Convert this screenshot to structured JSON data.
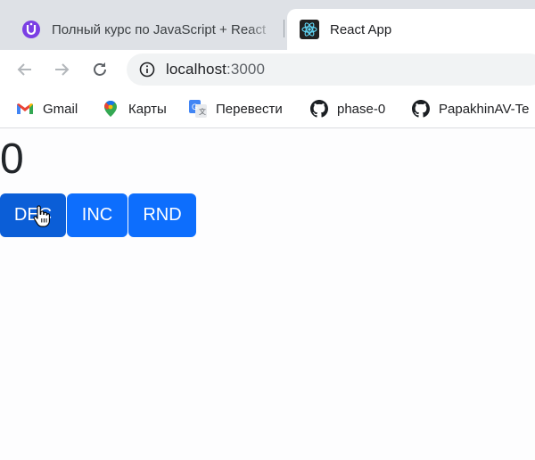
{
  "tabs": [
    {
      "title": "Полный курс по JavaScript + React",
      "favicon": "ulbi-logo-icon",
      "active": false
    },
    {
      "title": "React App",
      "favicon": "react-logo-icon",
      "active": true
    }
  ],
  "toolbar": {
    "url_host": "localhost",
    "url_port": ":3000"
  },
  "bookmarks": [
    {
      "label": "Gmail",
      "icon": "gmail-icon"
    },
    {
      "label": "Карты",
      "icon": "maps-icon"
    },
    {
      "label": "Перевести",
      "icon": "translate-icon"
    },
    {
      "label": "phase-0",
      "icon": "github-icon"
    },
    {
      "label": "PapakhinAV-Te",
      "icon": "github-icon"
    }
  ],
  "app": {
    "counter": "0",
    "buttons": {
      "dec": "DEC",
      "inc": "INC",
      "rnd": "RND"
    },
    "primary_color": "#0d6efd",
    "active_color": "#0b5ed7"
  }
}
